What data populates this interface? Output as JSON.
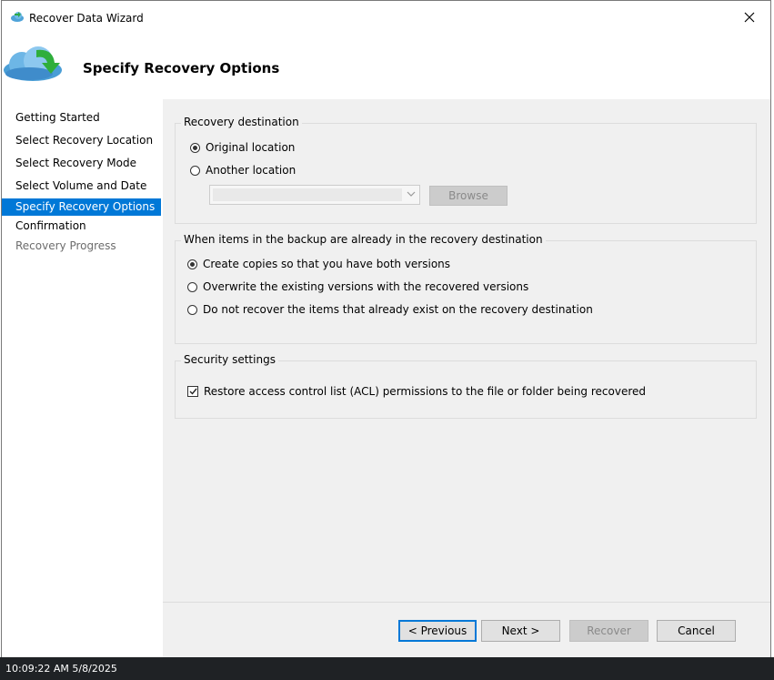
{
  "window": {
    "title": "Recover Data Wizard",
    "header_title": "Specify Recovery Options"
  },
  "sidebar": {
    "steps": [
      {
        "label": "Getting Started",
        "state": "normal"
      },
      {
        "label": "Select Recovery Location",
        "state": "normal"
      },
      {
        "label": "Select Recovery Mode",
        "state": "normal"
      },
      {
        "label": "Select Volume and Date",
        "state": "normal"
      },
      {
        "label": "Specify Recovery Options",
        "state": "active"
      },
      {
        "label": "Confirmation",
        "state": "normal"
      },
      {
        "label": "Recovery Progress",
        "state": "disabled"
      }
    ]
  },
  "destination": {
    "label": "Recovery destination",
    "original": "Original location",
    "another": "Another location",
    "selected": "original",
    "path_value": "",
    "browse_label": "Browse"
  },
  "conflict": {
    "label": "When items in the backup are already in the recovery destination",
    "options": [
      "Create copies so that you have both versions",
      "Overwrite the existing versions with the recovered versions",
      "Do not recover the items that already exist on the recovery destination"
    ],
    "selected_index": 0
  },
  "security": {
    "label": "Security settings",
    "acl_label": "Restore access control list (ACL) permissions to the file or folder being recovered",
    "acl_checked": true
  },
  "footer": {
    "previous": "< Previous",
    "next": "Next >",
    "recover": "Recover",
    "cancel": "Cancel"
  },
  "taskbar": {
    "clock": "10:09:22 AM 5/8/2025"
  },
  "colors": {
    "accent": "#0078d7",
    "panel": "#f0f0f0",
    "taskbar": "#1f2225"
  },
  "icons": {
    "title": "cloud-backup-icon",
    "header": "cloud-recover-arrow-icon",
    "close": "close-icon"
  }
}
